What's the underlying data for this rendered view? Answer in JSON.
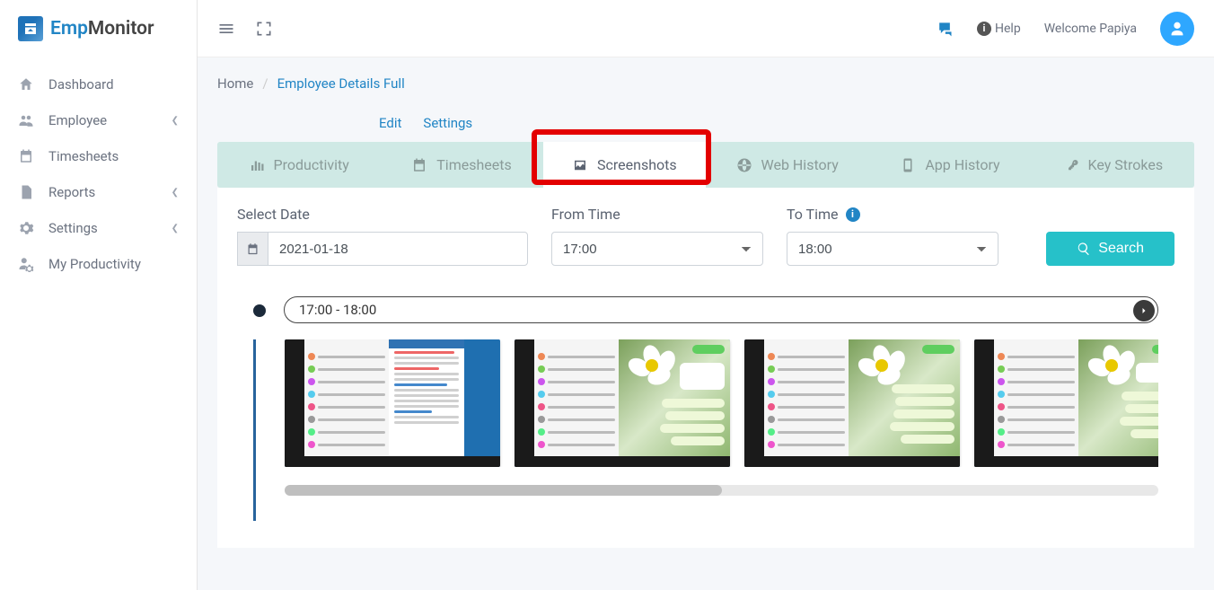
{
  "brand": {
    "emp": "Emp",
    "monitor": "Monitor"
  },
  "sidebar": {
    "items": [
      {
        "label": "Dashboard",
        "icon": "home",
        "expandable": false
      },
      {
        "label": "Employee",
        "icon": "users",
        "expandable": true
      },
      {
        "label": "Timesheets",
        "icon": "calendar",
        "expandable": false
      },
      {
        "label": "Reports",
        "icon": "document",
        "expandable": true
      },
      {
        "label": "Settings",
        "icon": "gear",
        "expandable": true
      },
      {
        "label": "My Productivity",
        "icon": "user-gear",
        "expandable": false
      }
    ]
  },
  "topbar": {
    "help": "Help",
    "welcome": "Welcome  Papiya"
  },
  "breadcrumb": {
    "home": "Home",
    "current": "Employee Details Full"
  },
  "actions": {
    "edit": "Edit",
    "settings": "Settings"
  },
  "tabs": [
    {
      "label": "Productivity",
      "icon": "chart"
    },
    {
      "label": "Timesheets",
      "icon": "calendar"
    },
    {
      "label": "Screenshots",
      "icon": "image",
      "active": true
    },
    {
      "label": "Web History",
      "icon": "globe"
    },
    {
      "label": "App History",
      "icon": "mobile"
    },
    {
      "label": "Key Strokes",
      "icon": "key"
    }
  ],
  "filters": {
    "dateLabel": "Select Date",
    "dateValue": "2021-01-18",
    "fromLabel": "From Time",
    "fromValue": "17:00",
    "toLabel": "To Time",
    "toValue": "18:00",
    "searchLabel": "Search"
  },
  "timeline": {
    "range": "17:00 - 18:00",
    "screenshotCount": 4
  },
  "colors": {
    "accent": "#26c1c9",
    "link": "#2185c5",
    "tabBg": "#cfe9e5",
    "highlight": "#e30000"
  }
}
